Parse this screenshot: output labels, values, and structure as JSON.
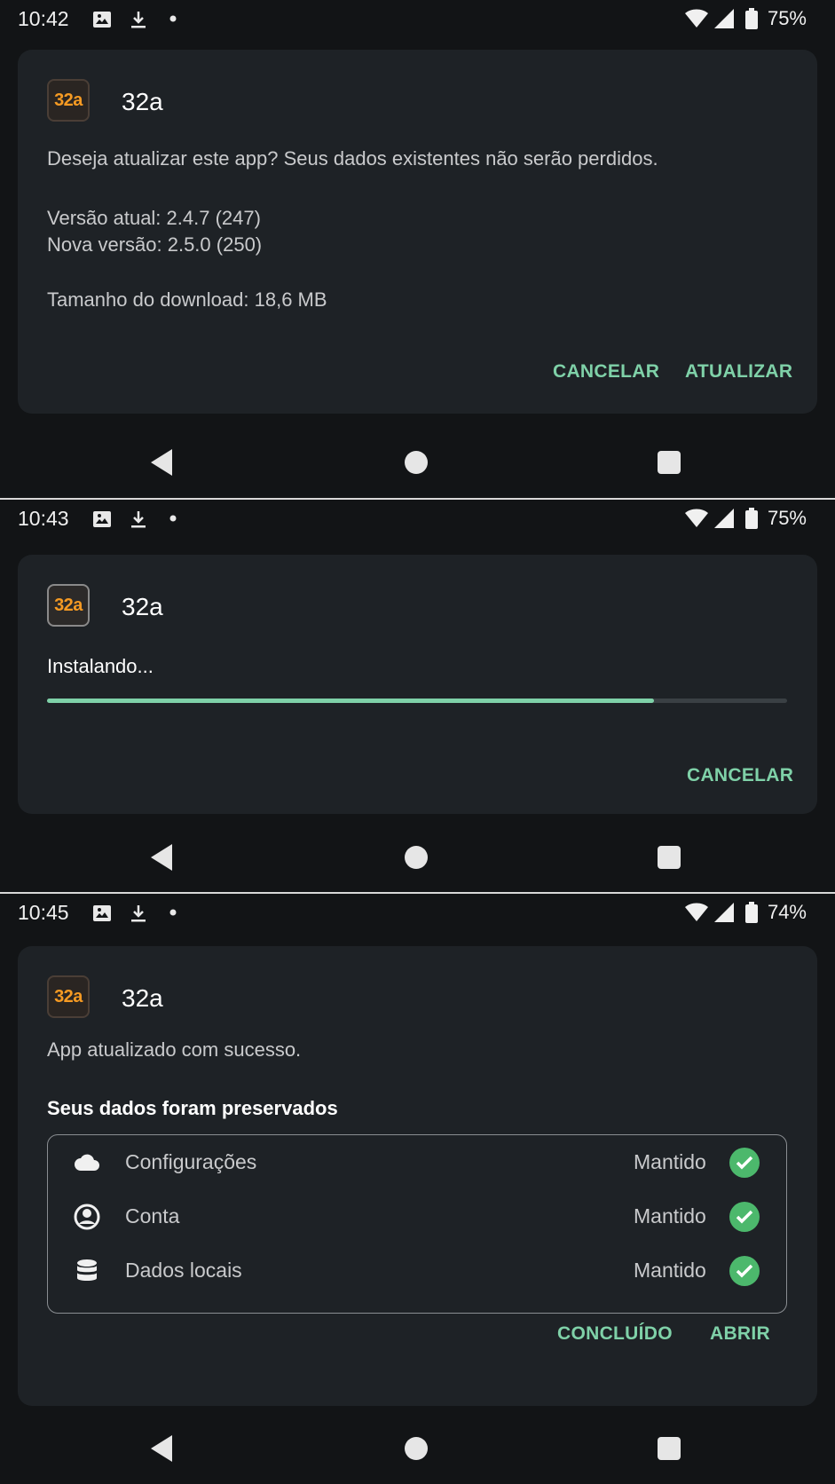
{
  "app": {
    "icon_text": "32a",
    "name": "32a",
    "icon_color": "#f59a23"
  },
  "accent": "#7fd1a8",
  "nav": {
    "back": "back-icon",
    "home": "home-icon",
    "recents": "recents-icon"
  },
  "screen1": {
    "status": {
      "time": "10:42",
      "battery": "75%"
    },
    "message": "Deseja atualizar este app? Seus dados existentes não serão perdidos.",
    "current_version": "Versão atual: 2.4.7 (247)",
    "new_version": "Nova versão: 2.5.0 (250)",
    "download_size": "Tamanho do download: 18,6 MB",
    "cancel_label": "CANCELAR",
    "update_label": "ATUALIZAR"
  },
  "screen2": {
    "status": {
      "time": "10:43",
      "battery": "75%"
    },
    "installing": "Instalando...",
    "progress_fraction": 0.82,
    "cancel_label": "CANCELAR"
  },
  "screen3": {
    "status": {
      "time": "10:45",
      "battery": "74%"
    },
    "message": "App atualizado com sucesso.",
    "preserved_title": "Seus dados foram preservados",
    "items": [
      {
        "label": "Configurações",
        "status": "Mantido",
        "icon": "cloud-icon"
      },
      {
        "label": "Conta",
        "status": "Mantido",
        "icon": "account-icon"
      },
      {
        "label": "Dados locais",
        "status": "Mantido",
        "icon": "database-icon"
      }
    ],
    "done_label": "CONCLUÍDO",
    "open_label": "ABRIR"
  }
}
